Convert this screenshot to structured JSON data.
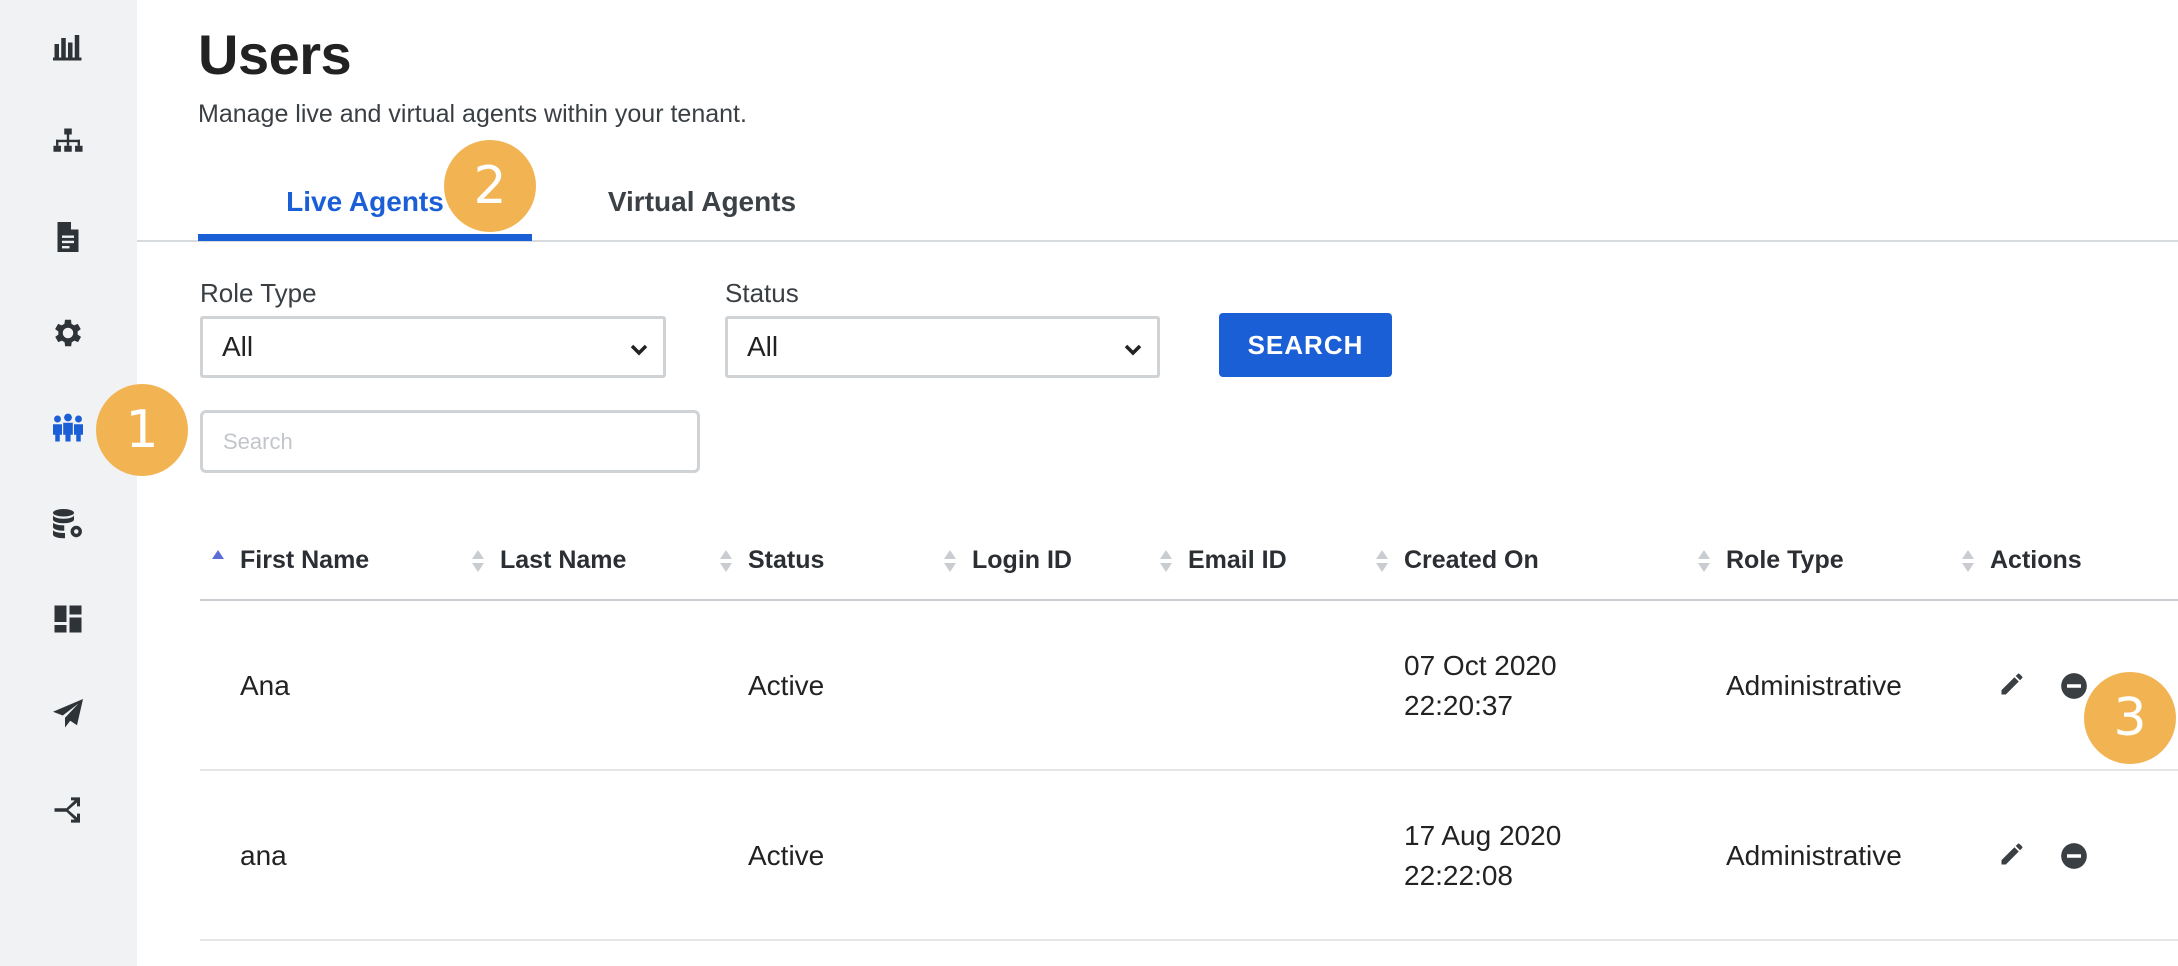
{
  "header": {
    "title": "Users",
    "subtitle": "Manage live and virtual agents within your tenant."
  },
  "sidebar": {
    "items": [
      {
        "icon": "bar-chart-icon"
      },
      {
        "icon": "hierarchy-icon"
      },
      {
        "icon": "document-icon"
      },
      {
        "icon": "gear-icon"
      },
      {
        "icon": "users-icon",
        "active": true
      },
      {
        "icon": "database-settings-icon"
      },
      {
        "icon": "dashboard-icon"
      },
      {
        "icon": "send-icon"
      },
      {
        "icon": "branch-icon"
      }
    ]
  },
  "tabs": [
    {
      "label": "Live Agents",
      "active": true
    },
    {
      "label": "Virtual Agents",
      "active": false
    }
  ],
  "filters": {
    "role_type_label": "Role Type",
    "role_type_value": "All",
    "status_label": "Status",
    "status_value": "All",
    "search_button": "SEARCH",
    "search_placeholder": "Search"
  },
  "table": {
    "columns": [
      "First Name",
      "Last Name",
      "Status",
      "Login ID",
      "Email ID",
      "Created On",
      "Role Type",
      "Actions"
    ],
    "rows": [
      {
        "first_name": "Ana",
        "last_name": "",
        "status": "Active",
        "login_id": "",
        "email_id": "",
        "created_date": "07 Oct 2020",
        "created_time": "22:20:37",
        "role_type": "Administrative"
      },
      {
        "first_name": "ana",
        "last_name": "",
        "status": "Active",
        "login_id": "",
        "email_id": "",
        "created_date": "17 Aug 2020",
        "created_time": "22:22:08",
        "role_type": "Administrative"
      }
    ]
  },
  "callouts": [
    "1",
    "2",
    "3"
  ],
  "colors": {
    "accent": "#1a5fd6",
    "sidebar_bg": "#f1f2f4",
    "callout": "#f2b452"
  }
}
